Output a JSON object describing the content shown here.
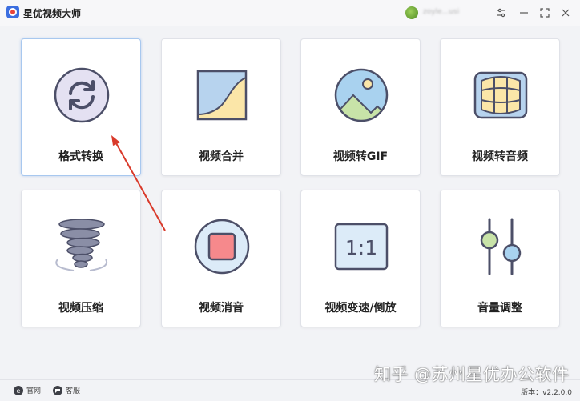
{
  "app": {
    "title": "星优视频大师",
    "user_name": "zoyle...usi"
  },
  "tools": [
    {
      "label": "格式转换",
      "icon": "convert-icon"
    },
    {
      "label": "视频合并",
      "icon": "merge-icon"
    },
    {
      "label": "视频转GIF",
      "icon": "gif-image-icon"
    },
    {
      "label": "视频转音频",
      "icon": "audio-icon"
    },
    {
      "label": "视频压缩",
      "icon": "tornado-compress-icon"
    },
    {
      "label": "视频消音",
      "icon": "mute-stop-icon"
    },
    {
      "label": "视频变速/倒放",
      "icon": "ratio-speed-icon"
    },
    {
      "label": "音量调整",
      "icon": "volume-slider-icon"
    }
  ],
  "ratio_text": "1:1",
  "status": {
    "website": "官网",
    "service": "客服",
    "version": "版本：v2.2.0.0"
  },
  "watermark": "知乎 @苏州星优办公软件"
}
